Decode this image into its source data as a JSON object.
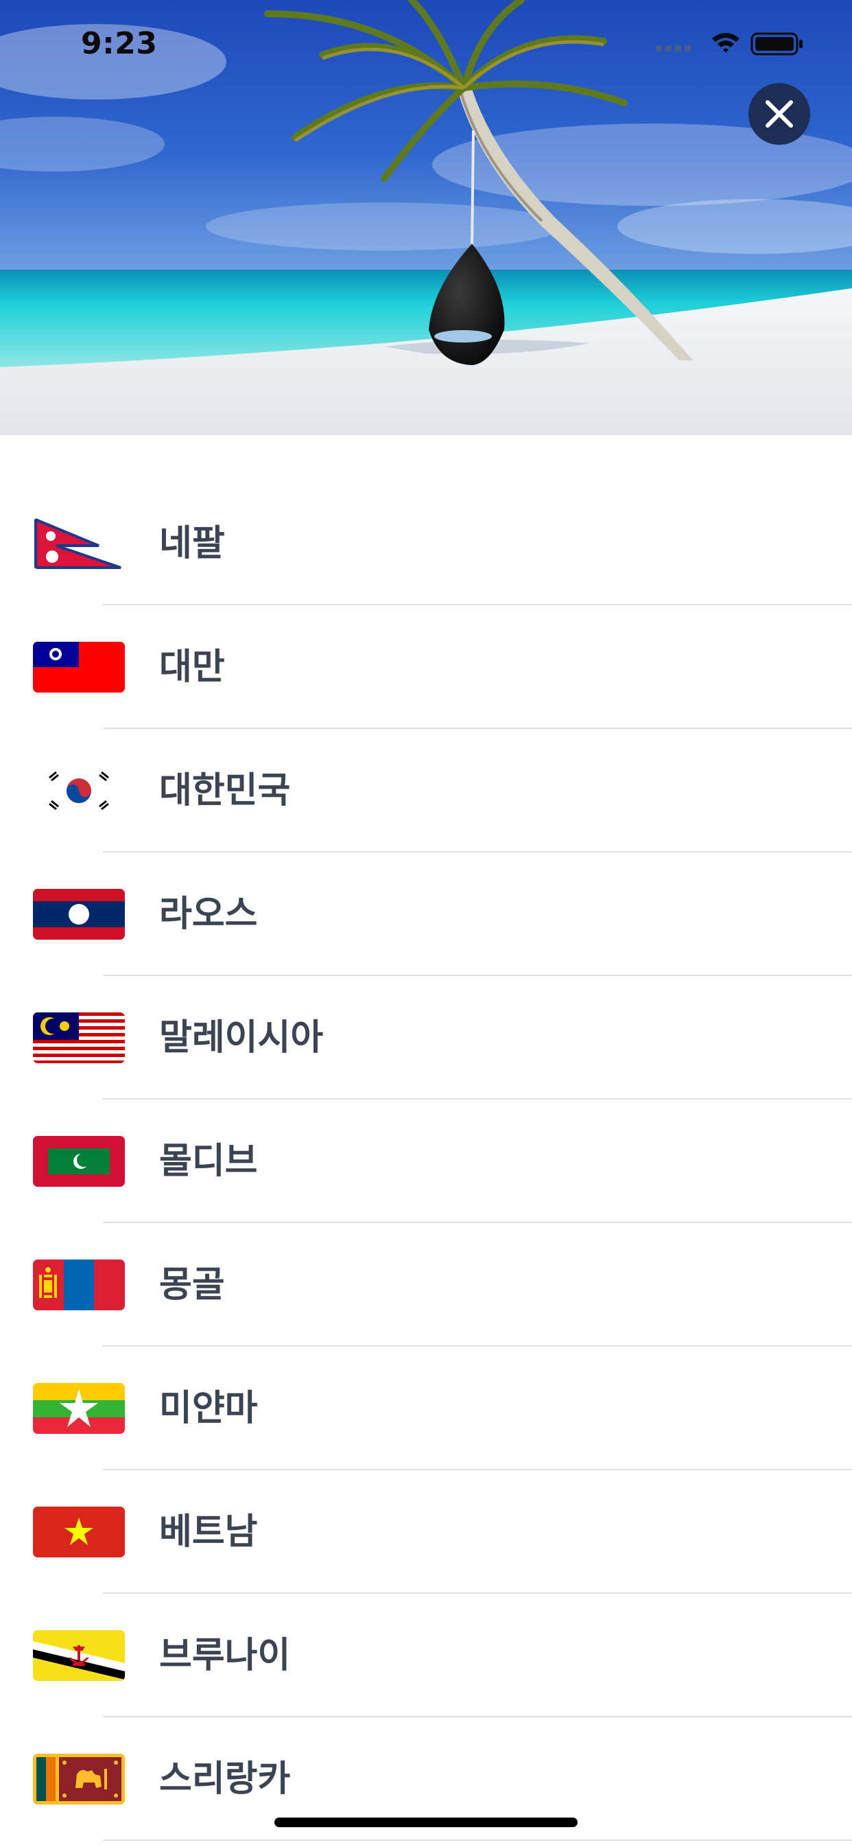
{
  "status_bar": {
    "time": "9:23"
  },
  "colors": {
    "close_button_bg": "#1e2d55",
    "country_text": "#3b4452",
    "divider": "#e1e1e4"
  },
  "countries": [
    {
      "name": "네팔",
      "flag": "nepal-flag"
    },
    {
      "name": "대만",
      "flag": "taiwan-flag"
    },
    {
      "name": "대한민국",
      "flag": "south-korea-flag"
    },
    {
      "name": "라오스",
      "flag": "laos-flag"
    },
    {
      "name": "말레이시아",
      "flag": "malaysia-flag"
    },
    {
      "name": "몰디브",
      "flag": "maldives-flag"
    },
    {
      "name": "몽골",
      "flag": "mongolia-flag"
    },
    {
      "name": "미얀마",
      "flag": "myanmar-flag"
    },
    {
      "name": "베트남",
      "flag": "vietnam-flag"
    },
    {
      "name": "브루나이",
      "flag": "brunei-flag"
    },
    {
      "name": "스리랑카",
      "flag": "sri-lanka-flag"
    }
  ]
}
